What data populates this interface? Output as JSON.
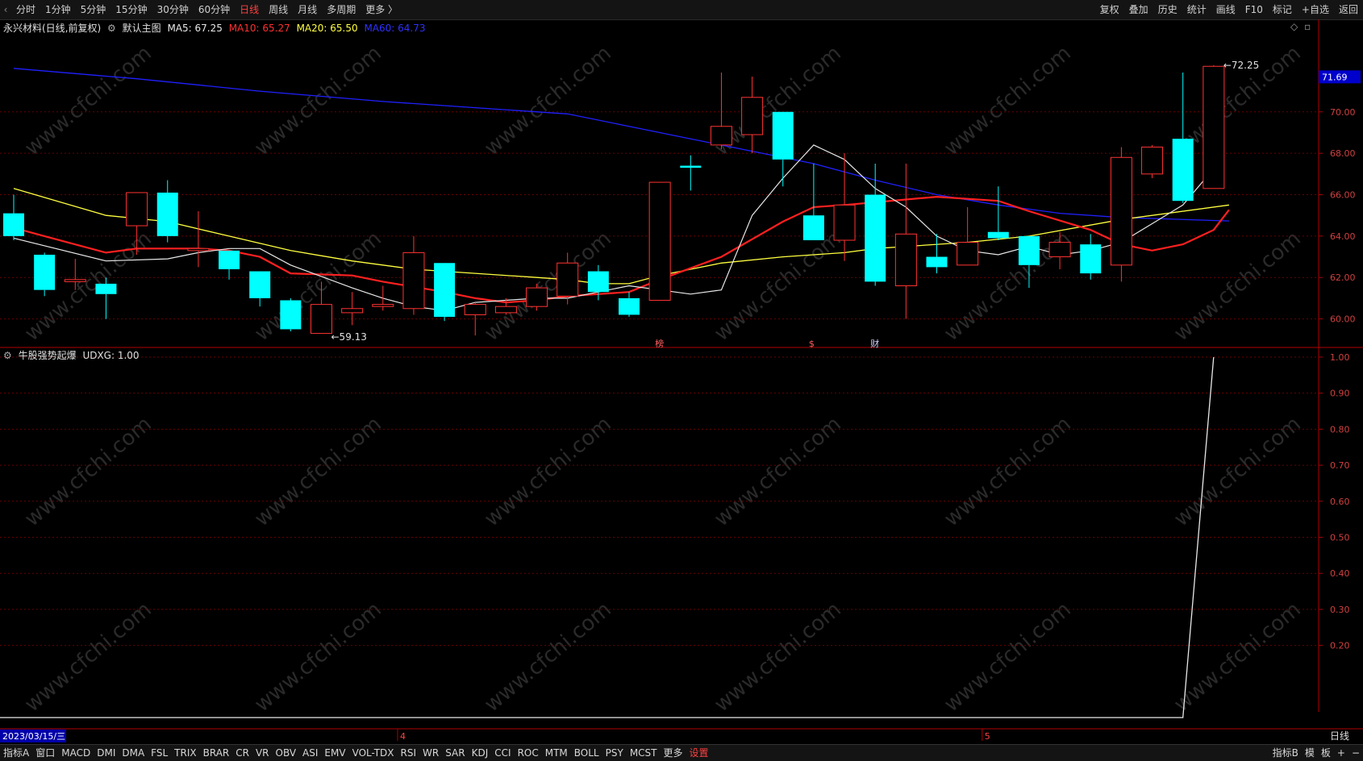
{
  "topbar": {
    "periods": [
      {
        "label": "分时",
        "active": false
      },
      {
        "label": "1分钟",
        "active": false
      },
      {
        "label": "5分钟",
        "active": false
      },
      {
        "label": "15分钟",
        "active": false
      },
      {
        "label": "30分钟",
        "active": false
      },
      {
        "label": "60分钟",
        "active": false
      },
      {
        "label": "日线",
        "active": true
      },
      {
        "label": "周线",
        "active": false
      },
      {
        "label": "月线",
        "active": false
      },
      {
        "label": "多周期",
        "active": false
      },
      {
        "label": "更多 〉",
        "active": false
      }
    ],
    "tools": [
      "复权",
      "叠加",
      "历史",
      "统计",
      "画线",
      "F10",
      "标记",
      "+自选",
      "返回"
    ]
  },
  "main_legend": {
    "stock": "永兴材料(日线,前复权)",
    "template": "默认主图",
    "ma5": "MA5: 67.25",
    "ma10": "MA10: 65.27",
    "ma20": "MA20: 65.50",
    "ma60": "MA60: 64.73"
  },
  "sub_legend": {
    "indicator": "牛股强势起爆",
    "value": "UDXG: 1.00"
  },
  "colors": {
    "up": "#ff3232",
    "down": "#00ffff",
    "ma5": "#e8e8e8",
    "ma10": "#ff2020",
    "ma20": "#ffff40",
    "ma60": "#2020ff",
    "grid": "#6a0000",
    "axis": "#b00000"
  },
  "chart_data": [
    {
      "type": "candlestick",
      "ylim": [
        58.7,
        73.3
      ],
      "y_ticks": [
        60.0,
        62.0,
        64.0,
        66.0,
        68.0,
        70.0
      ],
      "y_tick_labels": [
        "60.00",
        "62.00",
        "64.00",
        "66.00",
        "68.00",
        "70.00"
      ],
      "current_price_label": "71.69",
      "candles": [
        {
          "o": 65.1,
          "h": 66.0,
          "l": 63.8,
          "c": 64.0
        },
        {
          "o": 63.1,
          "h": 63.2,
          "l": 61.1,
          "c": 61.4
        },
        {
          "o": 61.8,
          "h": 62.9,
          "l": 61.4,
          "c": 61.9
        },
        {
          "o": 61.7,
          "h": 62.0,
          "l": 60.0,
          "c": 61.2
        },
        {
          "o": 64.5,
          "h": 66.1,
          "l": 63.1,
          "c": 66.1
        },
        {
          "o": 66.1,
          "h": 66.7,
          "l": 63.7,
          "c": 64.0
        },
        {
          "o": 63.3,
          "h": 65.2,
          "l": 62.5,
          "c": 63.4
        },
        {
          "o": 63.3,
          "h": 63.3,
          "l": 61.9,
          "c": 62.4
        },
        {
          "o": 62.3,
          "h": 62.3,
          "l": 60.6,
          "c": 61.0
        },
        {
          "o": 60.9,
          "h": 61.0,
          "l": 59.4,
          "c": 59.5
        },
        {
          "o": 59.3,
          "h": 61.8,
          "l": 59.3,
          "c": 60.7
        },
        {
          "o": 60.3,
          "h": 61.3,
          "l": 59.7,
          "c": 60.5
        },
        {
          "o": 60.6,
          "h": 61.6,
          "l": 60.4,
          "c": 60.7
        },
        {
          "o": 60.5,
          "h": 64.0,
          "l": 60.2,
          "c": 63.2
        },
        {
          "o": 62.7,
          "h": 62.7,
          "l": 59.9,
          "c": 60.1
        },
        {
          "o": 60.2,
          "h": 60.8,
          "l": 59.2,
          "c": 60.7
        },
        {
          "o": 60.3,
          "h": 61.0,
          "l": 60.2,
          "c": 60.6
        },
        {
          "o": 60.6,
          "h": 61.7,
          "l": 60.4,
          "c": 61.5
        },
        {
          "o": 61.1,
          "h": 63.2,
          "l": 60.7,
          "c": 62.7
        },
        {
          "o": 62.3,
          "h": 62.6,
          "l": 60.9,
          "c": 61.3
        },
        {
          "o": 61.0,
          "h": 61.3,
          "l": 60.1,
          "c": 60.2
        },
        {
          "o": 60.9,
          "h": 66.6,
          "l": 60.9,
          "c": 66.6
        },
        {
          "o": 67.4,
          "h": 67.9,
          "l": 66.2,
          "c": 67.3
        },
        {
          "o": 68.4,
          "h": 71.9,
          "l": 68.2,
          "c": 69.3
        },
        {
          "o": 68.9,
          "h": 71.7,
          "l": 68.0,
          "c": 70.7
        },
        {
          "o": 70.0,
          "h": 70.0,
          "l": 66.4,
          "c": 67.7
        },
        {
          "o": 65.0,
          "h": 67.5,
          "l": 63.8,
          "c": 63.8
        },
        {
          "o": 63.8,
          "h": 68.0,
          "l": 62.8,
          "c": 65.5
        },
        {
          "o": 66.0,
          "h": 67.5,
          "l": 61.6,
          "c": 61.8
        },
        {
          "o": 61.6,
          "h": 67.5,
          "l": 60.0,
          "c": 64.1
        },
        {
          "o": 63.0,
          "h": 64.1,
          "l": 62.2,
          "c": 62.5
        },
        {
          "o": 62.6,
          "h": 65.4,
          "l": 62.6,
          "c": 63.7
        },
        {
          "o": 64.2,
          "h": 66.4,
          "l": 63.8,
          "c": 63.9
        },
        {
          "o": 64.0,
          "h": 64.0,
          "l": 61.5,
          "c": 62.6
        },
        {
          "o": 63.0,
          "h": 64.2,
          "l": 62.4,
          "c": 63.7
        },
        {
          "o": 63.6,
          "h": 64.1,
          "l": 61.9,
          "c": 62.2
        },
        {
          "o": 62.6,
          "h": 68.3,
          "l": 61.8,
          "c": 67.8
        },
        {
          "o": 67.0,
          "h": 68.4,
          "l": 66.8,
          "c": 68.3
        },
        {
          "o": 68.7,
          "h": 71.9,
          "l": 65.6,
          "c": 65.7
        },
        {
          "o": 66.3,
          "h": 72.25,
          "l": 66.3,
          "c": 72.2
        }
      ],
      "ma5": [
        63.9,
        null,
        62.8,
        62.9,
        63.2,
        63.4,
        63.4,
        62.6,
        61.5,
        61.0,
        60.6,
        60.4,
        60.8,
        60.9,
        61.0,
        61.0,
        61.3,
        61.6,
        61.2,
        61.4,
        65.0,
        66.8,
        68.4,
        67.7,
        66.3,
        65.4,
        64.0,
        63.3,
        63.1,
        63.5,
        63.1,
        63.3,
        63.7,
        64.6,
        65.5,
        67.25
      ],
      "ma5_x": [
        0,
        1,
        3,
        5,
        6,
        7,
        8,
        9,
        11,
        12,
        13,
        14,
        15,
        16,
        17,
        18,
        19,
        20,
        22,
        23,
        24,
        25,
        26,
        27,
        28,
        29,
        30,
        31,
        32,
        33,
        34,
        35,
        36,
        37,
        38,
        39
      ],
      "ma10": [
        64.4,
        64.0,
        63.2,
        63.4,
        63.4,
        63.3,
        63.0,
        62.2,
        62.1,
        61.8,
        61.3,
        61.0,
        60.8,
        60.9,
        61.1,
        61.2,
        61.3,
        61.9,
        63.0,
        64.7,
        65.4,
        65.5,
        65.9,
        65.7,
        65.2,
        64.3,
        63.6,
        63.3,
        63.6,
        64.3,
        65.27
      ],
      "ma10_x": [
        0,
        1,
        3,
        4,
        6,
        7,
        8,
        9,
        11,
        12,
        14,
        15,
        16,
        17,
        18,
        19,
        20,
        21,
        23,
        25,
        26,
        27,
        30,
        32,
        33,
        35,
        36,
        37,
        38,
        39,
        39.5
      ],
      "ma20": [
        66.3,
        65.0,
        64.7,
        64.0,
        63.3,
        62.8,
        62.4,
        62.2,
        62.0,
        61.9,
        61.7,
        61.7,
        62.1,
        62.7,
        63.0,
        63.1,
        63.2,
        63.4,
        63.7,
        64.0,
        64.8,
        65.5
      ],
      "ma20_x": [
        0,
        3,
        5,
        7,
        9,
        11,
        13,
        15,
        17,
        18,
        19,
        20,
        21,
        23,
        25,
        26,
        27,
        28,
        31,
        33,
        36,
        39.5
      ],
      "ma60": [
        72.1,
        71.6,
        71.0,
        70.5,
        70.2,
        69.9,
        69.3,
        68.7,
        68.1,
        67.5,
        66.7,
        66.0,
        65.5,
        65.1,
        64.9,
        64.73
      ],
      "ma60_x": [
        0,
        4,
        8,
        12,
        15,
        18,
        20,
        22,
        24,
        26,
        28,
        30,
        32,
        34,
        36,
        39.5
      ],
      "annotations": [
        {
          "label": "59.13",
          "candle": 10,
          "price": 59.13
        },
        {
          "label": "72.25",
          "candle": 39,
          "price": 72.25
        }
      ],
      "event_marks": [
        {
          "label": "榜",
          "candle": 21
        },
        {
          "label": "$",
          "candle": 26
        },
        {
          "label": "财",
          "candle": 28
        }
      ]
    },
    {
      "type": "line",
      "series": [
        {
          "name": "UDXG",
          "values": [
            0,
            0,
            0,
            0,
            0,
            0,
            0,
            0,
            0,
            0,
            0,
            0,
            0,
            0,
            0,
            0,
            0,
            0,
            0,
            0,
            0,
            0,
            0,
            0,
            0,
            0,
            0,
            0,
            0,
            0,
            0,
            0,
            0,
            0,
            0,
            0,
            0,
            0,
            0,
            1.0
          ]
        }
      ],
      "ylim": [
        -0.02,
        1.02
      ],
      "y_ticks": [
        0.2,
        0.3,
        0.4,
        0.5,
        0.6,
        0.7,
        0.8,
        0.9,
        1.0
      ],
      "y_tick_labels": [
        "0.20",
        "0.30",
        "0.40",
        "0.50",
        "0.60",
        "0.70",
        "0.80",
        "0.90",
        "1.00"
      ]
    }
  ],
  "x_axis": {
    "date_label": "2023/03/15/三",
    "month_marks": [
      {
        "label": "4",
        "candle": 13
      },
      {
        "label": "5",
        "candle": 32
      }
    ],
    "period_label": "日线"
  },
  "watermark": "www.cfchi.com",
  "bottombar": {
    "items": [
      "指标A",
      "窗口",
      "MACD",
      "DMI",
      "DMA",
      "FSL",
      "TRIX",
      "BRAR",
      "CR",
      "VR",
      "OBV",
      "ASI",
      "EMV",
      "VOL-TDX",
      "RSI",
      "WR",
      "SAR",
      "KDJ",
      "CCI",
      "ROC",
      "MTM",
      "BOLL",
      "PSY",
      "MCST",
      "更多",
      "设置"
    ],
    "active_index": 25,
    "right_items": [
      "指标B",
      "模",
      "板",
      "+",
      "−"
    ]
  }
}
